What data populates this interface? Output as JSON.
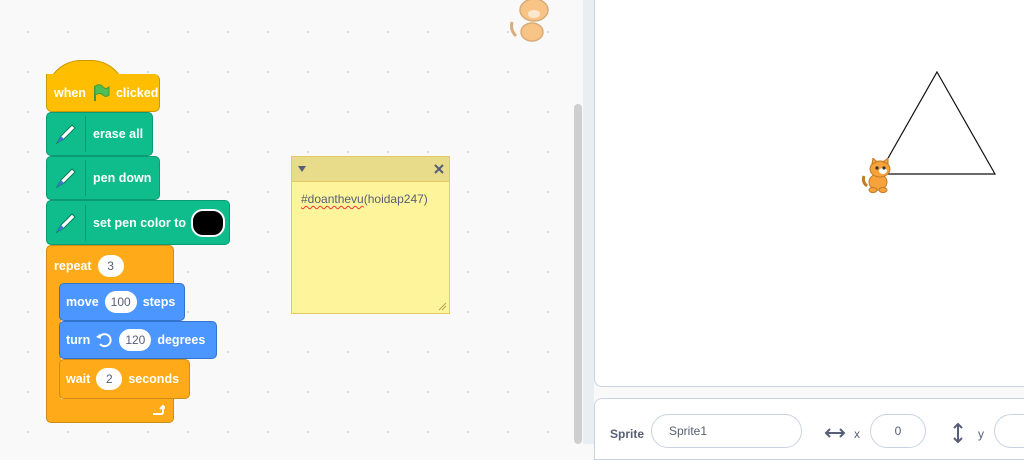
{
  "blocks": {
    "when_label": "when",
    "clicked_label": "clicked",
    "erase_all": "erase all",
    "pen_down": "pen down",
    "set_pen_color": "set pen color to",
    "pen_color": "#000000",
    "repeat_label": "repeat",
    "repeat_times": "3",
    "move_label": "move",
    "move_steps": "100",
    "steps_label": "steps",
    "turn_label": "turn",
    "turn_degrees": "120",
    "degrees_label": "degrees",
    "wait_label": "wait",
    "wait_seconds": "2",
    "seconds_label": "seconds"
  },
  "note": {
    "text_tag": "#doanthevu",
    "text_rest": "(hoidap247)"
  },
  "sprite_info": {
    "sprite_label": "Sprite",
    "sprite_name": "Sprite1",
    "x_label": "x",
    "x_value": "0",
    "y_label": "y"
  },
  "colors": {
    "events": "#ffbf00",
    "pen": "#0fbd8c",
    "control": "#ffab19",
    "motion": "#4c97ff",
    "note": "#fef49c"
  }
}
